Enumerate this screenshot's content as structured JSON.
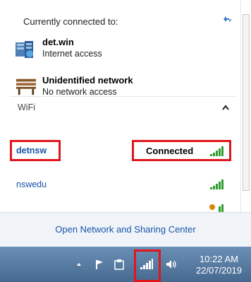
{
  "popup": {
    "header": "Currently connected to:",
    "connections": [
      {
        "name": "det.win",
        "status": "Internet access",
        "icon": "domain-network-icon"
      },
      {
        "name": "Unidentified network",
        "status": "No network access",
        "icon": "park-bench-icon"
      }
    ],
    "wifi_label": "WiFi",
    "wifi_networks": [
      {
        "name": "detnsw",
        "status": "Connected"
      },
      {
        "name": "nswedu",
        "status": ""
      }
    ],
    "footer_link": "Open Network and Sharing Center"
  },
  "taskbar": {
    "time": "10:22 AM",
    "date": "22/07/2019"
  },
  "colors": {
    "highlight": "#e0161d",
    "link": "#1a55a8",
    "signal": "#2f9e2f"
  }
}
